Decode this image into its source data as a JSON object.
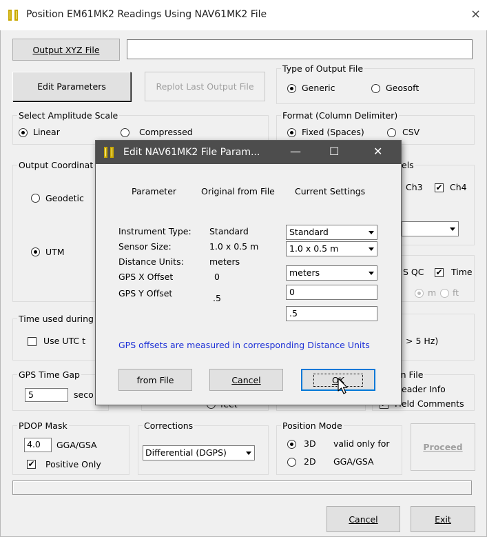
{
  "window": {
    "title": "Position EM61MK2 Readings Using NAV61MK2 File",
    "close_glyph": "×"
  },
  "output_file": {
    "button_label": "Output XYZ File",
    "path_value": ""
  },
  "buttons": {
    "edit_parameters": "Edit Parameters",
    "replot_last": "Replot Last Output File",
    "proceed": "Proceed",
    "cancel": "Cancel",
    "exit": "Exit"
  },
  "output_type": {
    "legend": "Type of Output File",
    "options": [
      "Generic",
      "Geosoft"
    ],
    "selected": "Generic"
  },
  "amplitude_scale": {
    "legend": "Select Amplitude Scale",
    "options": [
      "Linear",
      "Compressed"
    ],
    "selected": "Linear"
  },
  "format": {
    "legend": "Format (Column Delimiter)",
    "options": [
      "Fixed (Spaces)",
      "CSV"
    ],
    "selected": "Fixed (Spaces)"
  },
  "output_coordinates": {
    "legend_partial": "Output Coordinat",
    "options": [
      "Geodetic",
      "UTM"
    ],
    "selected": "UTM"
  },
  "channels": {
    "legend_partial": "els",
    "ch3_label": "Ch3",
    "ch4_label": "Ch4",
    "ch4_checked": "✔",
    "select_value": ""
  },
  "qc": {
    "qc_label_partial": "S QC",
    "time_label": "Time",
    "time_checked": "✔",
    "units": [
      "m",
      "ft"
    ]
  },
  "time_used": {
    "legend_partial": "Time used during",
    "use_utc_partial": "Use UTC t",
    "rate_partial": "> 5 Hz)"
  },
  "gps_time_gap": {
    "legend": "GPS Time Gap",
    "value": "5",
    "unit_partial": "seco"
  },
  "distance_units_partial": {
    "feet_label": "feet"
  },
  "include_in_file": {
    "legend_partial": "le in File",
    "header_partial": "eader Info",
    "field_comments": "Field Comments",
    "field_comments_checked": "✔"
  },
  "pdop": {
    "legend": "PDOP Mask",
    "value": "4.0",
    "suffix": "GGA/GSA",
    "positive_only": "Positive Only",
    "positive_checked": "✔"
  },
  "corrections": {
    "legend": "Corrections",
    "value": "Differential (DGPS)"
  },
  "position_mode": {
    "legend": "Position Mode",
    "options": [
      "3D",
      "2D"
    ],
    "selected": "3D",
    "note_line1": "valid only for",
    "note_line2": "GGA/GSA"
  },
  "dialog": {
    "title": "Edit NAV61MK2 File Param...",
    "minimize_glyph": "—",
    "maximize_glyph": "☐",
    "close_glyph": "✕",
    "headers": {
      "parameter": "Parameter",
      "original": "Original from File",
      "current": "Current Settings"
    },
    "rows": [
      {
        "name": "Instrument Type:",
        "original": "Standard",
        "current": "Standard"
      },
      {
        "name": "Sensor Size:",
        "original": "1.0 x 0.5 m",
        "current": "1.0 x 0.5 m"
      },
      {
        "name": "Distance Units:",
        "original": "meters",
        "current": "meters"
      },
      {
        "name": "GPS X Offset",
        "original": "0",
        "current": "0"
      },
      {
        "name": "GPS Y Offset",
        "original": ".5",
        "current": ".5"
      }
    ],
    "info_text": "GPS offsets are measured in corresponding Distance Units",
    "buttons": {
      "from_file": "from File",
      "cancel": "Cancel",
      "ok": "OK"
    }
  },
  "colors": {
    "window_bg": "#f0f0f0",
    "dialog_titlebar": "#4d4d4d",
    "info_text": "#1c2fd6",
    "focus_border": "#0078d7",
    "icon_yellow": "#c9a800"
  }
}
